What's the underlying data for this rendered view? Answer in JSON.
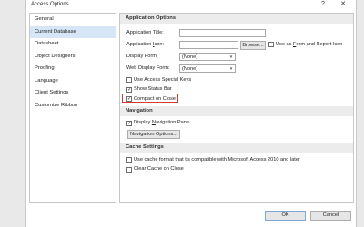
{
  "window": {
    "title": "Access Options",
    "help_label": "?",
    "close_label": "✕"
  },
  "sidebar": {
    "items": [
      {
        "label": "General"
      },
      {
        "label": "Current Database"
      },
      {
        "label": "Datasheet"
      },
      {
        "label": "Object Designers"
      },
      {
        "label": "Proofing"
      },
      {
        "label": "Language"
      },
      {
        "label": "Client Settings"
      },
      {
        "label": "Customize Ribbon"
      }
    ],
    "selected_index": 1
  },
  "application_options": {
    "header": "Application Options",
    "app_title_label": "Application Title:",
    "app_title_value": "",
    "app_icon_label_pre": "Application ",
    "app_icon_label_u": "I",
    "app_icon_label_post": "con:",
    "app_icon_value": "",
    "browse_label": "Browse...",
    "use_as_icon_label_pre": "Use as ",
    "use_as_icon_label_u": "F",
    "use_as_icon_label_post": "orm and Report Icon",
    "use_as_icon_checked": false,
    "display_form_label": "Display Form:",
    "display_form_value": "(None)",
    "web_display_form_label": "Web Display Form:",
    "web_display_form_value": "(None)",
    "use_access_special_keys_label": "Use Access Special Keys",
    "use_access_special_keys_checked": false,
    "show_status_bar_label": "Show Status Bar",
    "show_status_bar_checked": true,
    "compact_on_close_label": "Compact on Close",
    "compact_on_close_checked": true
  },
  "navigation": {
    "header": "Navigation",
    "display_nav_pane_label_pre": "Display ",
    "display_nav_pane_label_u": "N",
    "display_nav_pane_label_post": "avigation Pane",
    "display_nav_pane_checked": true,
    "nav_options_button": "Navigation Options..."
  },
  "cache_settings": {
    "header": "Cache Settings",
    "use_cache_format_label": "Use cache format that tis compatible with Microsoft Access 2010 and later",
    "use_cache_format_checked": false,
    "clear_cache_label": "Clear Cache on Close",
    "clear_cache_checked": false
  },
  "footer": {
    "ok_label": "OK",
    "cancel_label": "Cancel"
  },
  "colors": {
    "highlight": "#d43b2c",
    "selected_nav": "#d6e6f6"
  },
  "check_glyph": "✓"
}
